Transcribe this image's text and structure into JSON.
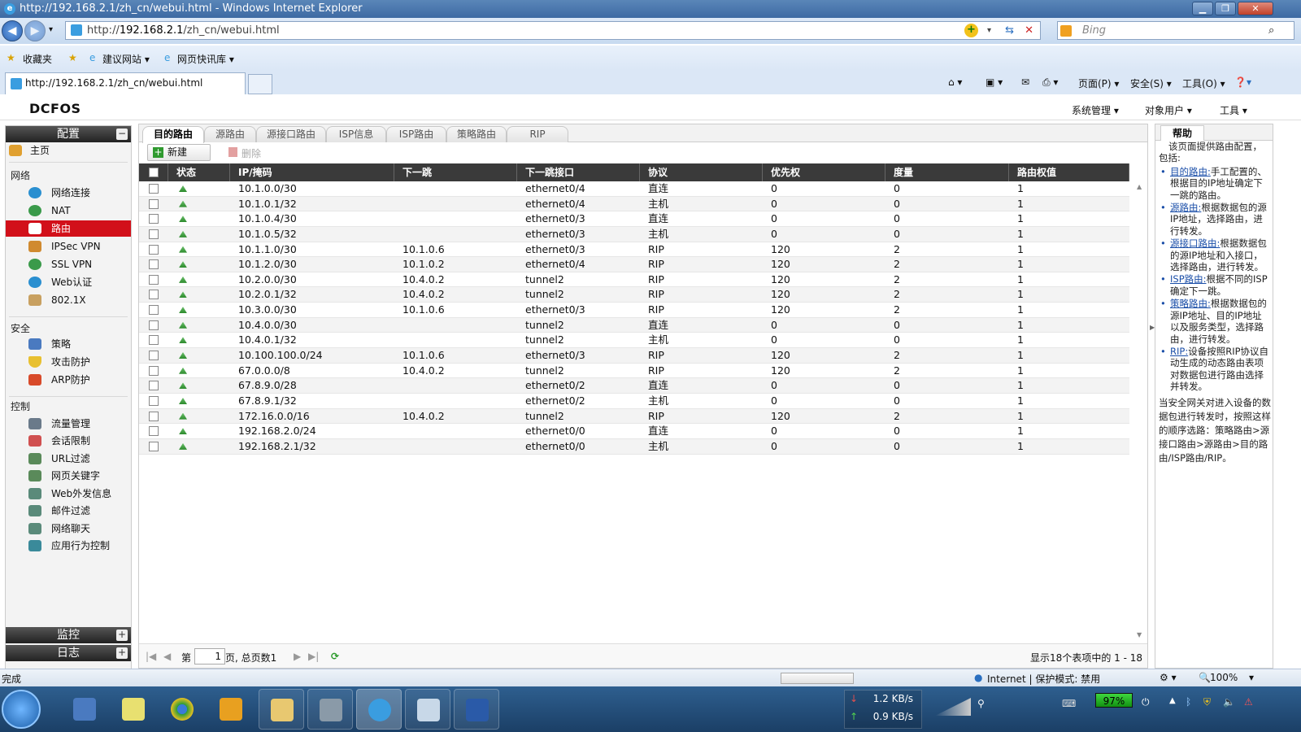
{
  "window": {
    "title": "http://192.168.2.1/zh_cn/webui.html - Windows Internet Explorer"
  },
  "browser": {
    "address_prefix": "http://",
    "address_host": "192.168.2.1",
    "address_path": "/zh_cn/webui.html",
    "search_placeholder": "Bing",
    "favorites_label": "收藏夹",
    "fav_links": [
      "建议网站 ▾",
      "网页快讯库 ▾"
    ],
    "tab_title": "http://192.168.2.1/zh_cn/webui.html",
    "cmd_menus": [
      "页面(P) ▾",
      "安全(S) ▾",
      "工具(O) ▾"
    ]
  },
  "app": {
    "logo": "DCFOS",
    "top_menu": [
      "系统管理 ▾",
      "对象用户 ▾",
      "工具 ▾"
    ]
  },
  "sidebar": {
    "header": "配置",
    "home": "主页",
    "groups": {
      "network": "网络",
      "security": "安全",
      "control": "控制"
    },
    "network_items": [
      "网络连接",
      "NAT",
      "路由",
      "IPSec VPN",
      "SSL VPN",
      "Web认证",
      "802.1X"
    ],
    "security_items": [
      "策略",
      "攻击防护",
      "ARP防护"
    ],
    "control_items": [
      "流量管理",
      "会话限制",
      "URL过滤",
      "网页关键字",
      "Web外发信息",
      "邮件过滤",
      "网络聊天",
      "应用行为控制"
    ],
    "monitor": "监控",
    "log": "日志",
    "colors": {
      "active": "#d2101a"
    }
  },
  "route_tabs": [
    "目的路由",
    "源路由",
    "源接口路由",
    "ISP信息",
    "ISP路由",
    "策略路由",
    "RIP"
  ],
  "toolbar": {
    "new_label": "新建",
    "delete_label": "删除"
  },
  "table": {
    "columns": [
      "状态",
      "IP/掩码",
      "下一跳",
      "下一跳接口",
      "协议",
      "优先权",
      "度量",
      "路由权值"
    ],
    "rows": [
      [
        "10.1.0.0/30",
        "",
        "ethernet0/4",
        "直连",
        "0",
        "0",
        "1"
      ],
      [
        "10.1.0.1/32",
        "",
        "ethernet0/4",
        "主机",
        "0",
        "0",
        "1"
      ],
      [
        "10.1.0.4/30",
        "",
        "ethernet0/3",
        "直连",
        "0",
        "0",
        "1"
      ],
      [
        "10.1.0.5/32",
        "",
        "ethernet0/3",
        "主机",
        "0",
        "0",
        "1"
      ],
      [
        "10.1.1.0/30",
        "10.1.0.6",
        "ethernet0/3",
        "RIP",
        "120",
        "2",
        "1"
      ],
      [
        "10.1.2.0/30",
        "10.1.0.2",
        "ethernet0/4",
        "RIP",
        "120",
        "2",
        "1"
      ],
      [
        "10.2.0.0/30",
        "10.4.0.2",
        "tunnel2",
        "RIP",
        "120",
        "2",
        "1"
      ],
      [
        "10.2.0.1/32",
        "10.4.0.2",
        "tunnel2",
        "RIP",
        "120",
        "2",
        "1"
      ],
      [
        "10.3.0.0/30",
        "10.1.0.6",
        "ethernet0/3",
        "RIP",
        "120",
        "2",
        "1"
      ],
      [
        "10.4.0.0/30",
        "",
        "tunnel2",
        "直连",
        "0",
        "0",
        "1"
      ],
      [
        "10.4.0.1/32",
        "",
        "tunnel2",
        "主机",
        "0",
        "0",
        "1"
      ],
      [
        "10.100.100.0/24",
        "10.1.0.6",
        "ethernet0/3",
        "RIP",
        "120",
        "2",
        "1"
      ],
      [
        "67.0.0.0/8",
        "10.4.0.2",
        "tunnel2",
        "RIP",
        "120",
        "2",
        "1"
      ],
      [
        "67.8.9.0/28",
        "",
        "ethernet0/2",
        "直连",
        "0",
        "0",
        "1"
      ],
      [
        "67.8.9.1/32",
        "",
        "ethernet0/2",
        "主机",
        "0",
        "0",
        "1"
      ],
      [
        "172.16.0.0/16",
        "10.4.0.2",
        "tunnel2",
        "RIP",
        "120",
        "2",
        "1"
      ],
      [
        "192.168.2.0/24",
        "",
        "ethernet0/0",
        "直连",
        "0",
        "0",
        "1"
      ],
      [
        "192.168.2.1/32",
        "",
        "ethernet0/0",
        "主机",
        "0",
        "0",
        "1"
      ]
    ]
  },
  "pager": {
    "prefix": "第",
    "page": "1",
    "suffix": "页, 总页数1",
    "summary": "显示18个表项中的 1 - 18"
  },
  "help": {
    "tab": "帮助",
    "intro": "该页面提供路由配置，包括:",
    "items": [
      {
        "link": "目的路由:",
        "text": "手工配置的、根据目的IP地址确定下一跳的路由。"
      },
      {
        "link": "源路由:",
        "text": "根据数据包的源IP地址，选择路由，进行转发。"
      },
      {
        "link": "源接口路由:",
        "text": "根据数据包的源IP地址和入接口，选择路由，进行转发。"
      },
      {
        "link": "ISP路由:",
        "text": "根据不同的ISP确定下一跳。"
      },
      {
        "link": "策略路由:",
        "text": "根据数据包的源IP地址、目的IP地址以及服务类型，选择路由，进行转发。"
      },
      {
        "link": "RIP:",
        "text": "设备按照RIP协议自动生成的动态路由表项对数据包进行路由选择并转发。"
      }
    ],
    "footer": "当安全网关对进入设备的数据包进行转发时，按照这样的顺序选路：策略路由>源接口路由>源路由>目的路由/ISP路由/RIP。"
  },
  "statusbar": {
    "left": "完成",
    "zone": "Internet | 保护模式: 禁用",
    "zoom": "100%"
  },
  "taskbar": {
    "net_down": "1.2 KB/s",
    "net_up": "0.9 KB/s",
    "battery": "97%"
  }
}
